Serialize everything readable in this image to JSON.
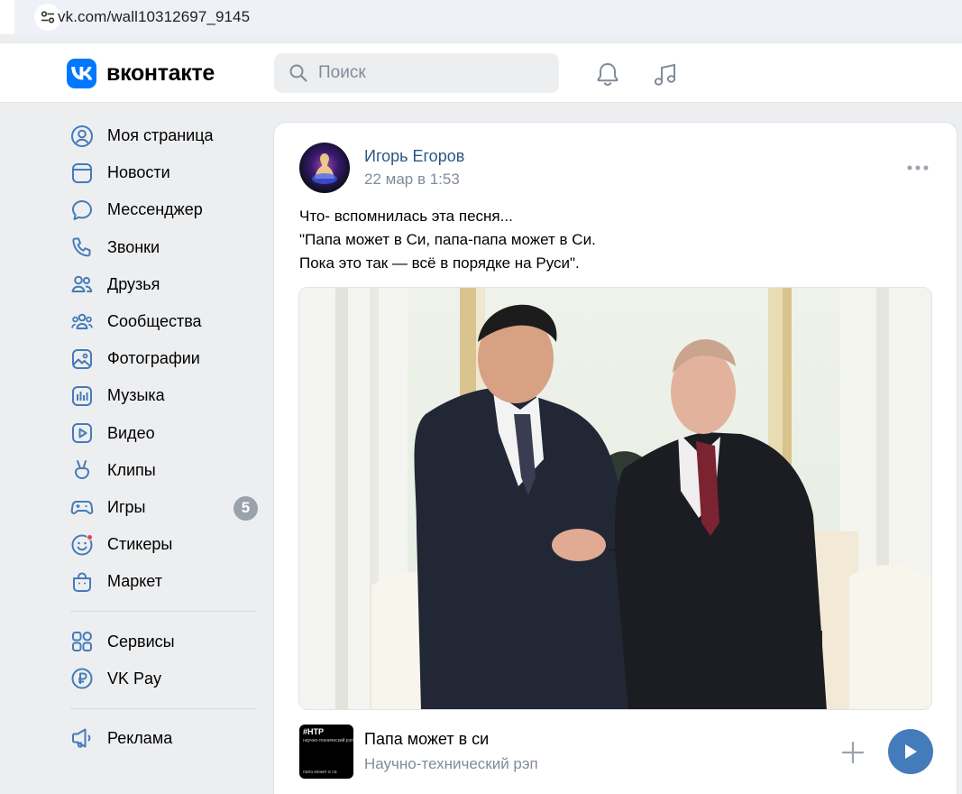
{
  "browser": {
    "url": "vk.com/wall10312697_9145"
  },
  "header": {
    "logo_text": "вконтакте",
    "search_placeholder": "Поиск",
    "accent_color": "#0077ff"
  },
  "sidebar": {
    "items": [
      {
        "label": "Моя страница",
        "icon": "user-circle-icon"
      },
      {
        "label": "Новости",
        "icon": "news-icon"
      },
      {
        "label": "Мессенджер",
        "icon": "message-icon"
      },
      {
        "label": "Звонки",
        "icon": "phone-icon"
      },
      {
        "label": "Друзья",
        "icon": "friends-icon"
      },
      {
        "label": "Сообщества",
        "icon": "communities-icon"
      },
      {
        "label": "Фотографии",
        "icon": "photos-icon"
      },
      {
        "label": "Музыка",
        "icon": "music-icon"
      },
      {
        "label": "Видео",
        "icon": "video-icon"
      },
      {
        "label": "Клипы",
        "icon": "clips-icon"
      },
      {
        "label": "Игры",
        "icon": "games-icon",
        "badge": "5"
      },
      {
        "label": "Стикеры",
        "icon": "stickers-icon"
      },
      {
        "label": "Маркет",
        "icon": "market-icon"
      }
    ],
    "secondary": [
      {
        "label": "Сервисы",
        "icon": "services-icon"
      },
      {
        "label": "VK Pay",
        "icon": "vkpay-icon"
      }
    ],
    "tertiary": [
      {
        "label": "Реклама",
        "icon": "ads-icon"
      }
    ]
  },
  "post": {
    "author": "Игорь Егоров",
    "date": "22 мар в 1:53",
    "text_lines": [
      "Что- вспомнилась эта песня...",
      "\"Папа может в Си, папа-папа может в Си.",
      "Пока это так — всё в порядке на Руси\"."
    ],
    "audio": {
      "title": "Папа может в си",
      "artist": "Научно-технический рэп",
      "cover_line1": "#НТР",
      "cover_line2": "научно-технический рэп",
      "cover_line3": "папа может в си"
    }
  }
}
